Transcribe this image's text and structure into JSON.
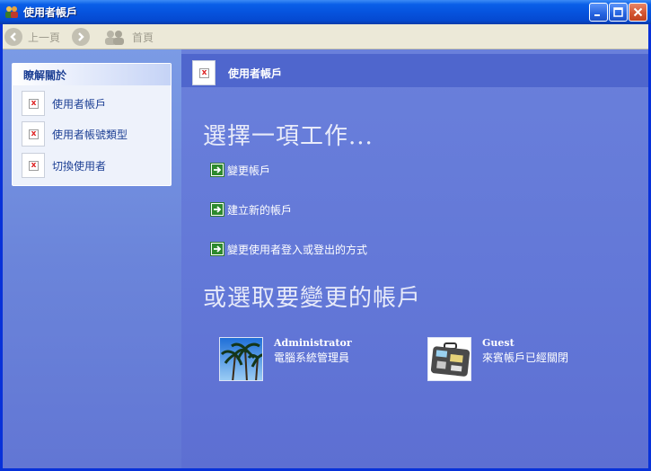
{
  "window": {
    "title": "使用者帳戶"
  },
  "toolbar": {
    "back_label": "上一頁",
    "home_label": "首頁"
  },
  "learn_about": {
    "heading": "瞭解關於",
    "items": [
      {
        "label": "使用者帳戶"
      },
      {
        "label": "使用者帳號類型"
      },
      {
        "label": "切換使用者"
      }
    ]
  },
  "main": {
    "header_title": "使用者帳戶",
    "pick_task_heading": "選擇一項工作...",
    "tasks": [
      {
        "label": "變更帳戶"
      },
      {
        "label": "建立新的帳戶"
      },
      {
        "label": "變更使用者登入或登出的方式"
      }
    ],
    "pick_account_heading": "或選取要變更的帳戶",
    "accounts": [
      {
        "name": "Administrator",
        "description": "電腦系統管理員",
        "picture": "palm-trees"
      },
      {
        "name": "Guest",
        "description": "來賓帳戶已經關閉",
        "picture": "briefcase"
      }
    ]
  },
  "colors": {
    "titlebar": "#0653de",
    "left_pane": "#7b9be5",
    "main_pane": "#6277d7",
    "header_band": "#4f66cd",
    "task_arrow": "#2d7a2d"
  }
}
